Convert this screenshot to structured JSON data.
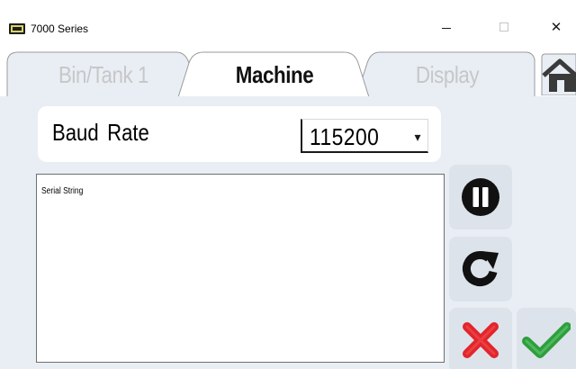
{
  "window": {
    "title": "7000 Series",
    "icon": "app-window-icon",
    "controls": {
      "minimize": "minimize-icon",
      "maximize": "maximize-icon",
      "close": "close-icon",
      "close_glyph": "✕"
    }
  },
  "tabs": [
    {
      "label": "Bin/Tank 1",
      "active": false
    },
    {
      "label": "Machine",
      "active": true
    },
    {
      "label": "Display",
      "active": false
    }
  ],
  "home_icon": "home-icon",
  "baud": {
    "label": "Baud Rate",
    "value": "115200",
    "dropdown_icon": "chevron-down-icon",
    "dropdown_glyph": "▾"
  },
  "serial": {
    "label": "Serial String"
  },
  "actions": {
    "pause_icon": "pause-icon",
    "refresh_icon": "refresh-icon",
    "cancel_icon": "cancel-x-icon",
    "ok_icon": "checkmark-icon"
  },
  "colors": {
    "panel_bg": "#e9eef5",
    "active_tab": "#ffffff",
    "inactive_tab": "#e9eef5",
    "inactive_tab_text": "#c7c7c7",
    "cancel_red": "#e0262c",
    "ok_green": "#2e9e3e"
  }
}
